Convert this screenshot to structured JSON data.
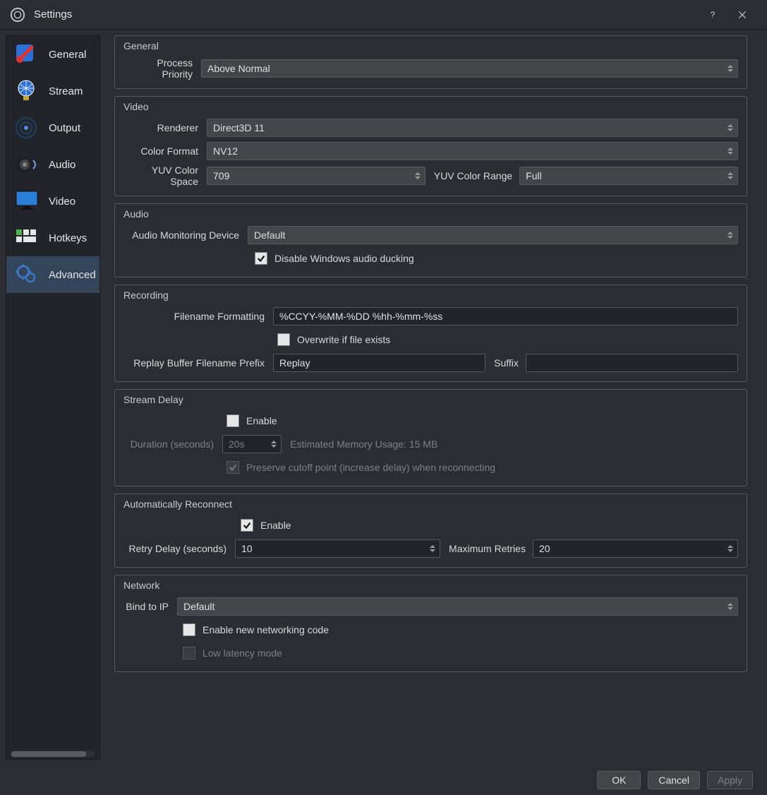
{
  "window": {
    "title": "Settings"
  },
  "sidebar": {
    "items": [
      {
        "label": "General"
      },
      {
        "label": "Stream"
      },
      {
        "label": "Output"
      },
      {
        "label": "Audio"
      },
      {
        "label": "Video"
      },
      {
        "label": "Hotkeys"
      },
      {
        "label": "Advanced"
      }
    ],
    "active_index": 6
  },
  "sections": {
    "general": {
      "title": "General",
      "process_priority_label": "Process Priority",
      "process_priority_value": "Above Normal"
    },
    "video": {
      "title": "Video",
      "renderer_label": "Renderer",
      "renderer_value": "Direct3D 11",
      "color_format_label": "Color Format",
      "color_format_value": "NV12",
      "color_space_label": "YUV Color Space",
      "color_space_value": "709",
      "color_range_label": "YUV Color Range",
      "color_range_value": "Full"
    },
    "audio": {
      "title": "Audio",
      "monitoring_label": "Audio Monitoring Device",
      "monitoring_value": "Default",
      "disable_ducking_label": "Disable Windows audio ducking",
      "disable_ducking_checked": true
    },
    "recording": {
      "title": "Recording",
      "filename_label": "Filename Formatting",
      "filename_value": "%CCYY-%MM-%DD %hh-%mm-%ss",
      "overwrite_label": "Overwrite if file exists",
      "overwrite_checked": false,
      "replay_prefix_label": "Replay Buffer Filename Prefix",
      "replay_prefix_value": "Replay",
      "suffix_label": "Suffix",
      "suffix_value": ""
    },
    "stream_delay": {
      "title": "Stream Delay",
      "enable_label": "Enable",
      "enable_checked": false,
      "duration_label": "Duration (seconds)",
      "duration_value": "20s",
      "estimated_label": "Estimated Memory Usage: 15 MB",
      "preserve_label": "Preserve cutoff point (increase delay) when reconnecting",
      "preserve_checked": true
    },
    "reconnect": {
      "title": "Automatically Reconnect",
      "enable_label": "Enable",
      "enable_checked": true,
      "retry_delay_label": "Retry Delay (seconds)",
      "retry_delay_value": "10",
      "max_retries_label": "Maximum Retries",
      "max_retries_value": "20"
    },
    "network": {
      "title": "Network",
      "bind_label": "Bind to IP",
      "bind_value": "Default",
      "new_code_label": "Enable new networking code",
      "new_code_checked": false,
      "low_latency_label": "Low latency mode",
      "low_latency_checked": false
    }
  },
  "footer": {
    "ok": "OK",
    "cancel": "Cancel",
    "apply": "Apply"
  }
}
